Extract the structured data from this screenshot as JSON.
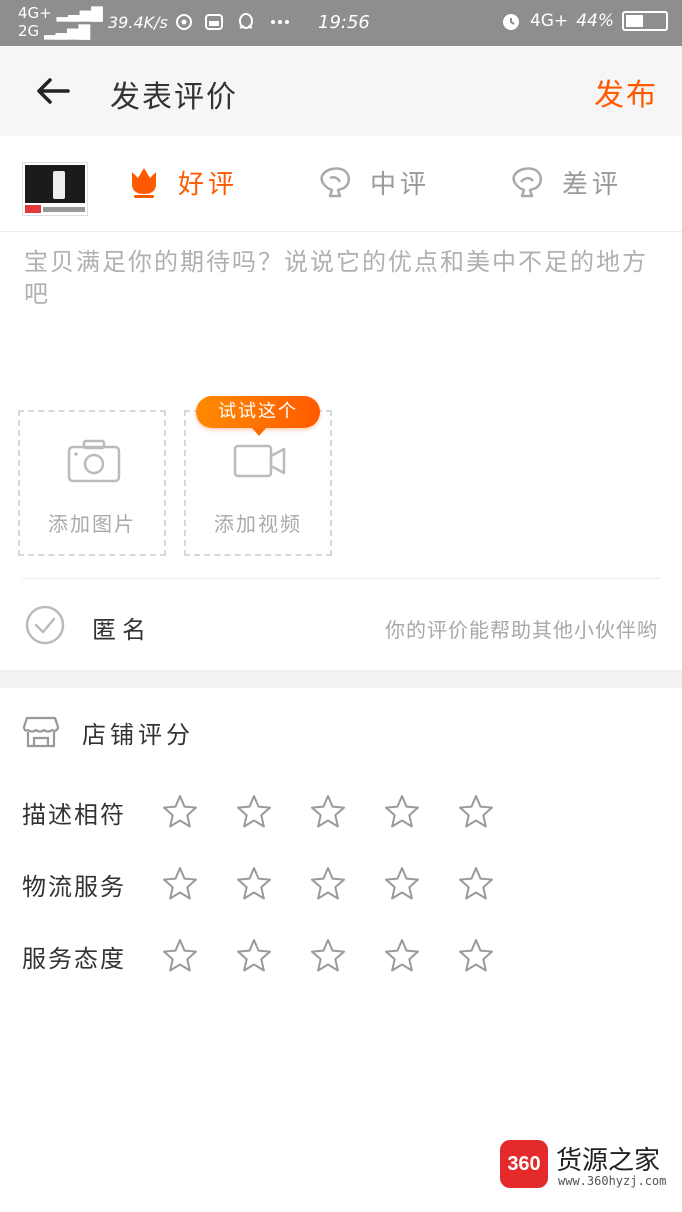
{
  "status_bar": {
    "network_top": "4G+",
    "network_bottom": "2G",
    "speed": "39.4K/s",
    "time": "19:56",
    "network_right": "4G+",
    "battery": "44%",
    "battery_level": 0.44
  },
  "header": {
    "title": "发表评价",
    "publish": "发布"
  },
  "rating_options": [
    {
      "label": "好评",
      "selected": true
    },
    {
      "label": "中评",
      "selected": false
    },
    {
      "label": "差评",
      "selected": false
    }
  ],
  "review": {
    "placeholder": "宝贝满足你的期待吗？说说它的优点和美中不足的地方吧"
  },
  "uploads": {
    "photo_label": "添加图片",
    "video_label": "添加视频",
    "video_tip": "试试这个"
  },
  "anonymous": {
    "label": "匿名",
    "hint": "你的评价能帮助其他小伙伴哟"
  },
  "shop_score": {
    "title": "店铺评分",
    "rows": [
      {
        "name": "描述相符",
        "rating": 0,
        "max": 5
      },
      {
        "name": "物流服务",
        "rating": 0,
        "max": 5
      },
      {
        "name": "服务态度",
        "rating": 0,
        "max": 5
      }
    ]
  },
  "watermark": {
    "badge": "360",
    "name": "货源之家",
    "url": "www.360hyzj.com"
  },
  "colors": {
    "accent": "#ff5a00",
    "muted": "#9a9a9a"
  }
}
